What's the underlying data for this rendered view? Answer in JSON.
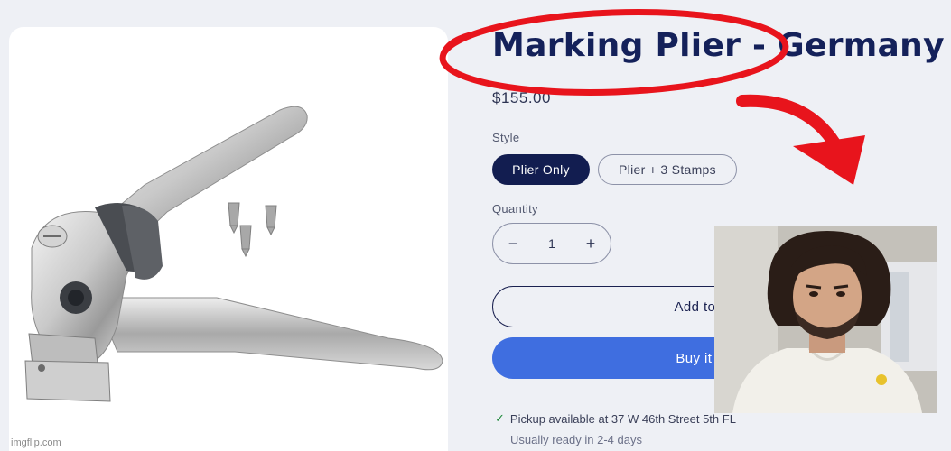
{
  "product": {
    "title": "Marking Plier - Germany",
    "price": "$155.00",
    "style_label": "Style",
    "styles": [
      "Plier Only",
      "Plier + 3 Stamps"
    ],
    "selected_style": "Plier Only",
    "quantity_label": "Quantity",
    "quantity": "1",
    "decrement": "−",
    "increment": "+",
    "add_to_cart": "Add to cart",
    "buy_now": "Buy it now",
    "pickup_text": "Pickup available at 37 W 46th Street 5th FL",
    "ready_text": "Usually ready in 2-4 days",
    "check_icon": "✓"
  },
  "watermark": "imgflip.com",
  "colors": {
    "title": "#14215a",
    "selected_pill": "#121d50",
    "buy_button": "#3f6ee0",
    "annotation_red": "#e8141c",
    "background": "#eef0f5"
  },
  "icons": {
    "product_image": "marking-plier-image",
    "annotation_circle": "red-ellipse",
    "annotation_arrow": "red-curved-arrow",
    "reaction_photo": "man-reaction-photo"
  }
}
